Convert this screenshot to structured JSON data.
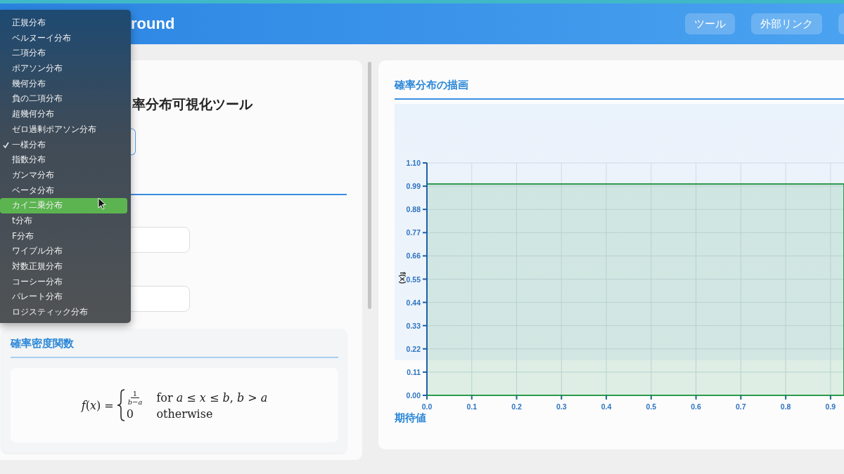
{
  "header": {
    "title": "round",
    "buttons": [
      "ツール",
      "外部リンク"
    ]
  },
  "left_panel": {
    "heading": "率分布可視化ツール",
    "density": {
      "title": "確率密度関数",
      "formula": {
        "lhs": "*f*(*x*) =",
        "cases": [
          {
            "numerator": "1",
            "denominator": "*b*−*a*",
            "condition": "for *a* ≤ *x* ≤ *b*, *b* > *a*"
          },
          {
            "value": "0",
            "condition": "otherwise"
          }
        ]
      }
    }
  },
  "chart_panel": {
    "title": "確率分布の描画",
    "chart_data": {
      "type": "area",
      "ylabel": "f(x)",
      "grid": true,
      "x": [
        0,
        0.93
      ],
      "series": [
        {
          "color": "#2e9a4c",
          "values": [
            1,
            1
          ]
        }
      ],
      "xlim": [
        0,
        0.93
      ],
      "ylim": [
        0,
        1.1
      ],
      "xticks": [
        {
          "value": 0,
          "label": "0.0"
        },
        {
          "value": 0.1,
          "label": "0.1"
        },
        {
          "value": 0.2,
          "label": "0.2"
        },
        {
          "value": 0.3,
          "label": "0.3"
        },
        {
          "value": 0.4,
          "label": "0.4"
        },
        {
          "value": 0.5,
          "label": "0.5"
        },
        {
          "value": 0.6,
          "label": "0.6"
        },
        {
          "value": 0.7,
          "label": "0.7"
        },
        {
          "value": 0.8,
          "label": "0.8"
        },
        {
          "value": 0.9,
          "label": "0.9"
        }
      ],
      "yticks": [
        {
          "value": 0,
          "label": "0.00"
        },
        {
          "value": 0.11,
          "label": "0.11"
        },
        {
          "value": 0.22,
          "label": "0.22"
        },
        {
          "value": 0.33,
          "label": "0.33"
        },
        {
          "value": 0.44,
          "label": "0.44"
        },
        {
          "value": 0.55,
          "label": "0.55"
        },
        {
          "value": 0.66,
          "label": "0.66"
        },
        {
          "value": 0.77,
          "label": "0.77"
        },
        {
          "value": 0.88,
          "label": "0.88"
        },
        {
          "value": 0.99,
          "label": "0.99"
        },
        {
          "value": 1.1,
          "label": "1.10"
        }
      ]
    },
    "next_section": "期待値"
  },
  "dropdown": {
    "items": [
      {
        "label": "正規分布",
        "checked": false,
        "highlighted": false
      },
      {
        "label": "ベルヌーイ分布",
        "checked": false,
        "highlighted": false
      },
      {
        "label": "二項分布",
        "checked": false,
        "highlighted": false
      },
      {
        "label": "ポアソン分布",
        "checked": false,
        "highlighted": false
      },
      {
        "label": "幾何分布",
        "checked": false,
        "highlighted": false
      },
      {
        "label": "負の二項分布",
        "checked": false,
        "highlighted": false
      },
      {
        "label": "超幾何分布",
        "checked": false,
        "highlighted": false
      },
      {
        "label": "ゼロ過剰ポアソン分布",
        "checked": false,
        "highlighted": false
      },
      {
        "label": "一様分布",
        "checked": true,
        "highlighted": false
      },
      {
        "label": "指数分布",
        "checked": false,
        "highlighted": false
      },
      {
        "label": "ガンマ分布",
        "checked": false,
        "highlighted": false
      },
      {
        "label": "ベータ分布",
        "checked": false,
        "highlighted": false
      },
      {
        "label": "カイ二乗分布",
        "checked": false,
        "highlighted": true
      },
      {
        "label": "t分布",
        "checked": false,
        "highlighted": false
      },
      {
        "label": "F分布",
        "checked": false,
        "highlighted": false
      },
      {
        "label": "ワイブル分布",
        "checked": false,
        "highlighted": false
      },
      {
        "label": "対数正規分布",
        "checked": false,
        "highlighted": false
      },
      {
        "label": "コーシー分布",
        "checked": false,
        "highlighted": false
      },
      {
        "label": "パレート分布",
        "checked": false,
        "highlighted": false
      },
      {
        "label": "ロジスティック分布",
        "checked": false,
        "highlighted": false
      }
    ]
  }
}
